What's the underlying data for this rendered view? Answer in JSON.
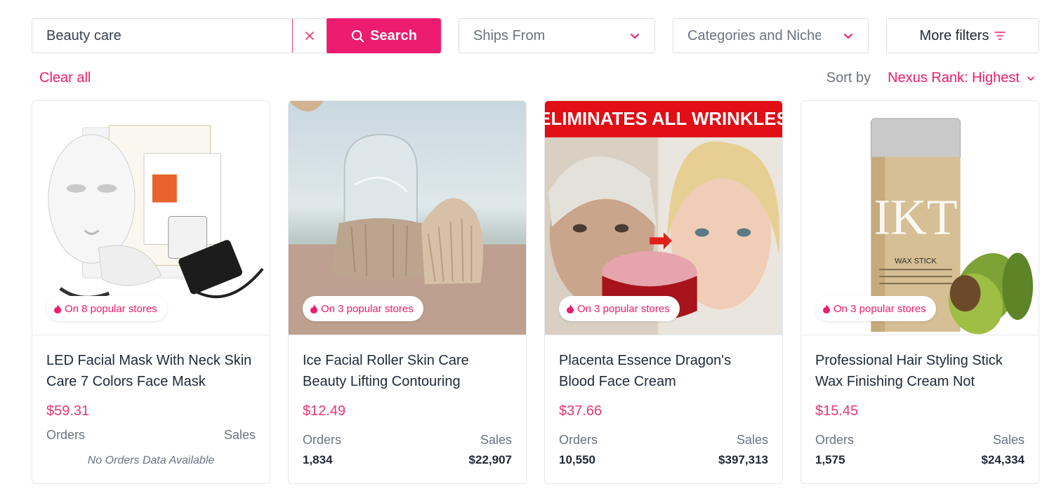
{
  "search": {
    "value": "Beauty care",
    "clear_icon": "close-icon",
    "button_label": "Search"
  },
  "filters": {
    "ships_from": "Ships From",
    "categories": "Categories and Niches",
    "more_filters": "More filters"
  },
  "clear_all": "Clear all",
  "sort": {
    "label": "Sort by",
    "value": "Nexus Rank: Highest"
  },
  "colors": {
    "accent": "#ee1c6e",
    "border": "#dcdfe6",
    "muted": "#6b7280"
  },
  "products": [
    {
      "image_icon": "led-face-mask-image",
      "badge": "On 8 popular stores",
      "title": "LED Facial Mask With Neck Skin Care 7 Colors Face Mask",
      "price": "$59.31",
      "orders_label": "Orders",
      "sales_label": "Sales",
      "no_data": "No Orders Data Available"
    },
    {
      "image_icon": "ice-roller-image",
      "badge": "On 3 popular stores",
      "title": "Ice Facial Roller Skin Care Beauty Lifting Contouring",
      "price": "$12.49",
      "orders_label": "Orders",
      "sales_label": "Sales",
      "orders": "1,834",
      "sales": "$22,907"
    },
    {
      "image_icon": "face-cream-image",
      "image_banner": "ELIMINATES ALL WRINKLES",
      "badge": "On 3 popular stores",
      "title": "Placenta Essence Dragon's Blood Face Cream",
      "price": "$37.66",
      "orders_label": "Orders",
      "sales_label": "Sales",
      "orders": "10,550",
      "sales": "$397,313"
    },
    {
      "image_icon": "hair-wax-stick-image",
      "image_brand": "IKT",
      "image_label": "WAX STICK",
      "badge": "On 3 popular stores",
      "title": "Professional Hair Styling Stick Wax Finishing Cream Not",
      "price": "$15.45",
      "orders_label": "Orders",
      "sales_label": "Sales",
      "orders": "1,575",
      "sales": "$24,334"
    }
  ]
}
